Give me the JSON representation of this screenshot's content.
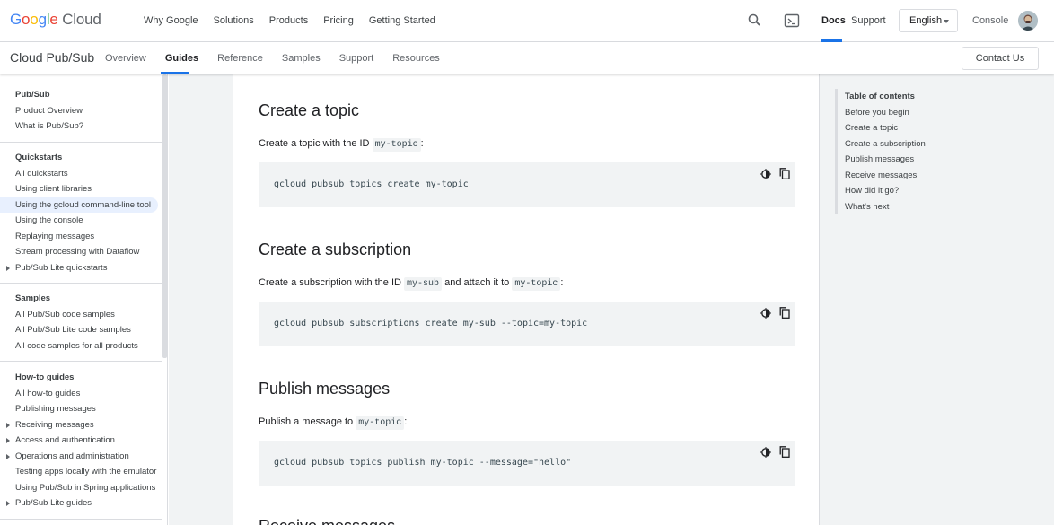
{
  "topbar": {
    "logo_text": "Google Cloud",
    "nav": [
      "Why Google",
      "Solutions",
      "Products",
      "Pricing",
      "Getting Started"
    ],
    "docs_label": "Docs",
    "support_label": "Support",
    "language": "English",
    "console_label": "Console",
    "icons": [
      "search-icon",
      "terminal-icon",
      "chevron-down-icon"
    ]
  },
  "subbar": {
    "product": "Cloud Pub/Sub",
    "tabs": [
      "Overview",
      "Guides",
      "Reference",
      "Samples",
      "Support",
      "Resources"
    ],
    "active_tab": "Guides",
    "contact_label": "Contact Us"
  },
  "leftnav": {
    "sections": [
      {
        "heading": "Pub/Sub",
        "items": [
          "Product Overview",
          "What is Pub/Sub?"
        ]
      },
      {
        "heading": "Quickstarts",
        "items": [
          "All quickstarts",
          "Using client libraries",
          "Using the gcloud command-line tool",
          "Using the console",
          "Replaying messages",
          "Stream processing with Dataflow",
          "Pub/Sub Lite quickstarts"
        ]
      },
      {
        "heading": "Samples",
        "items": [
          "All Pub/Sub code samples",
          "All Pub/Sub Lite code samples",
          "All code samples for all products"
        ]
      },
      {
        "heading": "How-to guides",
        "items": [
          "All how-to guides",
          "Publishing messages",
          "Receiving messages",
          "Access and authentication",
          "Operations and administration",
          "Testing apps locally with the emulator",
          "Using Pub/Sub in Spring applications",
          "Pub/Sub Lite guides"
        ]
      }
    ],
    "active_item": "Using the gcloud command-line tool"
  },
  "content": {
    "sections": [
      {
        "title": "Create a topic",
        "text_before": "Create a topic with the ID ",
        "code1": "my-topic",
        "text_mid": "",
        "code2": "",
        "text_after": ":",
        "command": "gcloud pubsub topics create my-topic"
      },
      {
        "title": "Create a subscription",
        "text_before": "Create a subscription with the ID ",
        "code1": "my-sub",
        "text_mid": " and attach it to ",
        "code2": "my-topic",
        "text_after": ":",
        "command": "gcloud pubsub subscriptions create my-sub --topic=my-topic"
      },
      {
        "title": "Publish messages",
        "text_before": "Publish a message to ",
        "code1": "my-topic",
        "text_mid": "",
        "code2": "",
        "text_after": ":",
        "command": "gcloud pubsub topics publish my-topic --message=\"hello\""
      },
      {
        "title": "Receive messages"
      }
    ]
  },
  "toc": {
    "title": "Table of contents",
    "items": [
      "Before you begin",
      "Create a topic",
      "Create a subscription",
      "Publish messages",
      "Receive messages",
      "How did it go?",
      "What's next"
    ]
  }
}
